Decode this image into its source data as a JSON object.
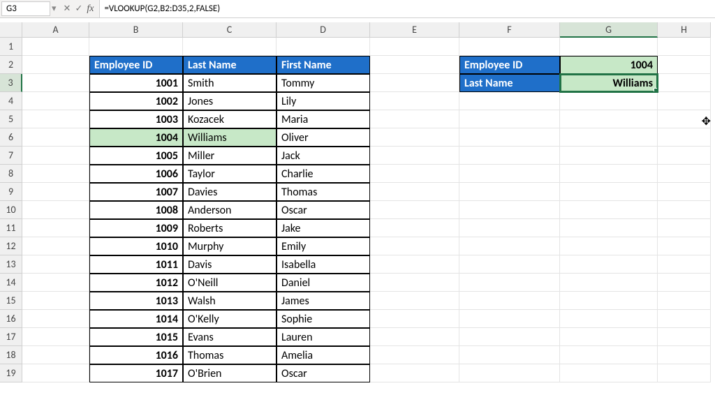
{
  "formula_bar": {
    "cell_ref": "G3",
    "dropdown_icon": "▾",
    "cancel_icon": "✕",
    "confirm_icon": "✓",
    "fx_label": "fx",
    "formula": "=VLOOKUP(G2,B2:D35,2,FALSE)"
  },
  "columns": [
    "A",
    "B",
    "C",
    "D",
    "E",
    "F",
    "G",
    "H"
  ],
  "row_labels": [
    "1",
    "2",
    "3",
    "4",
    "5",
    "6",
    "7",
    "8",
    "9",
    "10",
    "11",
    "12",
    "13",
    "14",
    "15",
    "16",
    "17",
    "18",
    "19"
  ],
  "headers": {
    "emp_id": "Employee ID",
    "last_name": "Last Name",
    "first_name": "First Name"
  },
  "employees": [
    {
      "id": "1001",
      "last": "Smith",
      "first": "Tommy"
    },
    {
      "id": "1002",
      "last": "Jones",
      "first": "Lily"
    },
    {
      "id": "1003",
      "last": "Kozacek",
      "first": "Maria"
    },
    {
      "id": "1004",
      "last": "Williams",
      "first": "Oliver"
    },
    {
      "id": "1005",
      "last": "Miller",
      "first": "Jack"
    },
    {
      "id": "1006",
      "last": "Taylor",
      "first": "Charlie"
    },
    {
      "id": "1007",
      "last": "Davies",
      "first": "Thomas"
    },
    {
      "id": "1008",
      "last": "Anderson",
      "first": "Oscar"
    },
    {
      "id": "1009",
      "last": "Roberts",
      "first": "Jake"
    },
    {
      "id": "1010",
      "last": "Murphy",
      "first": "Emily"
    },
    {
      "id": "1011",
      "last": "Davis",
      "first": "Isabella"
    },
    {
      "id": "1012",
      "last": "O'Neill",
      "first": "Daniel"
    },
    {
      "id": "1013",
      "last": "Walsh",
      "first": "James"
    },
    {
      "id": "1014",
      "last": "O'Kelly",
      "first": "Sophie"
    },
    {
      "id": "1015",
      "last": "Evans",
      "first": "Lauren"
    },
    {
      "id": "1016",
      "last": "Thomas",
      "first": "Amelia"
    },
    {
      "id": "1017",
      "last": "O'Brien",
      "first": "Oscar"
    }
  ],
  "lookup": {
    "label_id": "Employee ID",
    "label_last": "Last Name",
    "value_id": "1004",
    "value_last": "Williams"
  },
  "cursor": "✥"
}
